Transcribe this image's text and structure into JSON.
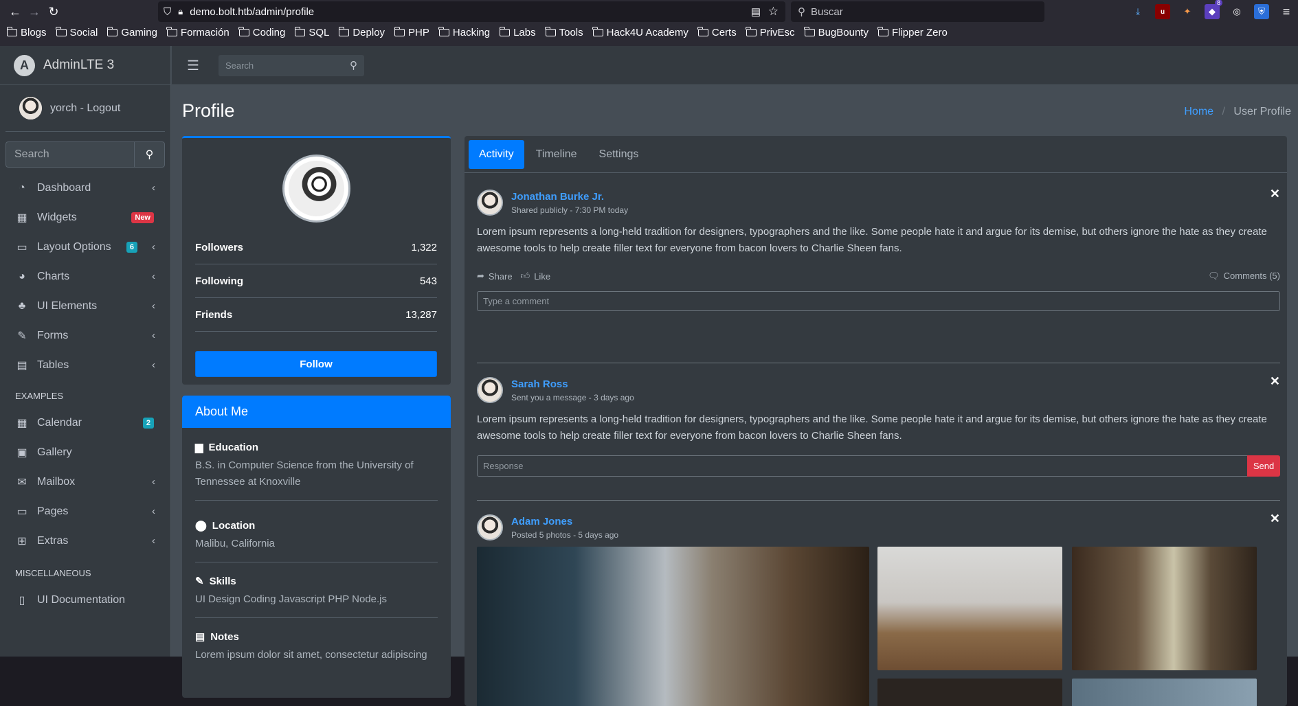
{
  "browser": {
    "url": "demo.bolt.htb/admin/profile",
    "search_placeholder": "Buscar",
    "ext_badge": "8",
    "bookmarks": [
      "Blogs",
      "Social",
      "Gaming",
      "Formación",
      "Coding",
      "SQL",
      "Deploy",
      "PHP",
      "Hacking",
      "Labs",
      "Tools",
      "Hack4U Academy",
      "Certs",
      "PrivEsc",
      "BugBounty",
      "Flipper Zero"
    ]
  },
  "sidebar": {
    "brand": "AdminLTE 3",
    "user": "yorch - Logout",
    "search_placeholder": "Search",
    "items": [
      {
        "label": "Dashboard"
      },
      {
        "label": "Widgets",
        "badge": "New"
      },
      {
        "label": "Layout Options",
        "badge": "6"
      },
      {
        "label": "Charts"
      },
      {
        "label": "UI Elements"
      },
      {
        "label": "Forms"
      },
      {
        "label": "Tables"
      }
    ],
    "examples_header": "EXAMPLES",
    "examples": [
      {
        "label": "Calendar",
        "badge": "2"
      },
      {
        "label": "Gallery"
      },
      {
        "label": "Mailbox"
      },
      {
        "label": "Pages"
      },
      {
        "label": "Extras"
      }
    ],
    "misc_header": "MISCELLANEOUS",
    "misc": [
      {
        "label": "UI Documentation"
      }
    ]
  },
  "topbar": {
    "search_placeholder": "Search"
  },
  "page": {
    "title": "Profile",
    "breadcrumb_home": "Home",
    "breadcrumb_sep": "/",
    "breadcrumb_current": "User Profile"
  },
  "profile": {
    "stats": [
      {
        "label": "Followers",
        "value": "1,322"
      },
      {
        "label": "Following",
        "value": "543"
      },
      {
        "label": "Friends",
        "value": "13,287"
      }
    ],
    "follow_label": "Follow"
  },
  "about": {
    "title": "About Me",
    "sections": [
      {
        "title": "Education",
        "text": "B.S. in Computer Science from the University of Tennessee at Knoxville"
      },
      {
        "title": "Location",
        "text": "Malibu, California"
      },
      {
        "title": "Skills",
        "text": "UI Design Coding Javascript PHP Node.js"
      },
      {
        "title": "Notes",
        "text": "Lorem ipsum dolor sit amet, consectetur adipiscing"
      }
    ]
  },
  "tabs": [
    "Activity",
    "Timeline",
    "Settings"
  ],
  "posts": [
    {
      "name": "Jonathan Burke Jr.",
      "desc": "Shared publicly - 7:30 PM today",
      "body": "Lorem ipsum represents a long-held tradition for designers, typographers and the like. Some people hate it and argue for its demise, but others ignore the hate as they create awesome tools to help create filler text for everyone from bacon lovers to Charlie Sheen fans.",
      "share": "Share",
      "like": "Like",
      "comments": "Comments (5)",
      "comment_placeholder": "Type a comment"
    },
    {
      "name": "Sarah Ross",
      "desc": "Sent you a message - 3 days ago",
      "body": "Lorem ipsum represents a long-held tradition for designers, typographers and the like. Some people hate it and argue for its demise, but others ignore the hate as they create awesome tools to help create filler text for everyone from bacon lovers to Charlie Sheen fans.",
      "response_placeholder": "Response",
      "send": "Send"
    },
    {
      "name": "Adam Jones",
      "desc": "Posted 5 photos - 5 days ago"
    }
  ],
  "colors": {
    "accent": "#007bff",
    "danger": "#dc3545",
    "info": "#17a2b8",
    "link": "#3f9eff"
  }
}
